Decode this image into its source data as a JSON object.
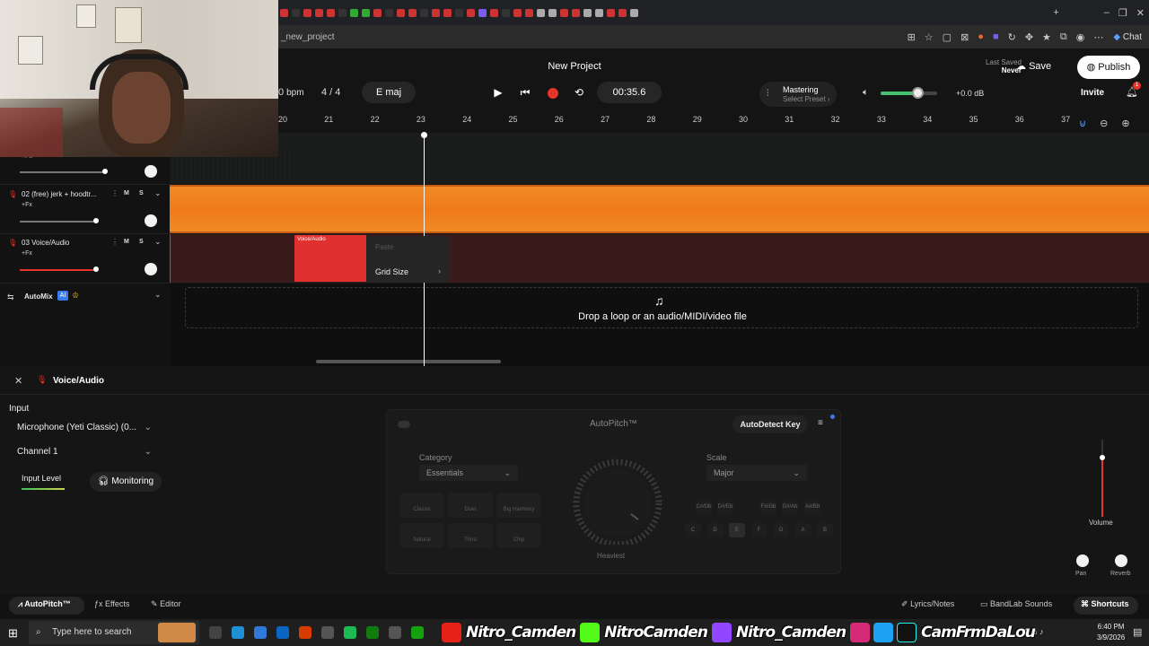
{
  "browser": {
    "url": "_new_project",
    "chat_label": "Chat"
  },
  "header": {
    "project_title": "New Project",
    "bpm_value": "0",
    "bpm_unit": "bpm",
    "time_signature": "4 / 4",
    "key": "E maj",
    "time": "00:35.6",
    "mastering_title": "Mastering",
    "mastering_sub": "Select Preset ›",
    "db": "+0.0 dB",
    "last_saved_label": "Last Saved",
    "last_saved_value": "Never",
    "save_label": "Save",
    "publish_label": "Publish",
    "invite_label": "Invite",
    "notifications": "1"
  },
  "ruler": [
    "20",
    "21",
    "22",
    "23",
    "24",
    "25",
    "26",
    "27",
    "28",
    "29",
    "30",
    "31",
    "32",
    "33",
    "34",
    "35",
    "36",
    "37"
  ],
  "tracks": [
    {
      "name": "",
      "fx": "+Fx"
    },
    {
      "name": "02  (free) jerk + hoodtr...",
      "fx": "+Fx",
      "m": "M",
      "s": "S"
    },
    {
      "name": "03  Voice/Audio",
      "fx": "+Fx",
      "m": "M",
      "s": "S",
      "clip": "Voice/Audio"
    }
  ],
  "automix": {
    "label": "AutoMix",
    "badge": "AI"
  },
  "dropzone": "Drop a loop or an audio/MIDI/video file",
  "context_menu": {
    "paste": "Paste",
    "grid": "Grid Size"
  },
  "panel": {
    "track_name": "Voice/Audio",
    "input_label": "Input",
    "mic": "Microphone (Yeti Classic) (0...",
    "channel": "Channel 1",
    "input_level": "Input Level",
    "monitoring": "Monitoring",
    "autopitch_title": "AutoPitch™",
    "autodetect": "AutoDetect Key",
    "category_label": "Category",
    "category_value": "Essentials",
    "scale_label": "Scale",
    "scale_value": "Major",
    "heaviest": "Heaviest",
    "presets": [
      "Classic",
      "Duet",
      "Big Harmony",
      "Natural",
      "Third",
      "Chip"
    ],
    "keys_top": [
      "C#/Db",
      "D#/Eb",
      "F#/Gb",
      "G#/Ab",
      "A#/Bb"
    ],
    "keys_bottom": [
      "C",
      "D",
      "E",
      "F",
      "G",
      "A",
      "B"
    ],
    "volume": "Volume",
    "pan": "Pan",
    "reverb": "Reverb"
  },
  "bottombar": {
    "autopitch": "AutoPitch™",
    "effects": "Effects",
    "editor": "Editor",
    "lyrics": "Lyrics/Notes",
    "sounds": "BandLab Sounds",
    "shortcuts": "Shortcuts"
  },
  "taskbar": {
    "search_placeholder": "Type here to search",
    "overlay": [
      "Nitro_Camden",
      "NitroCamden",
      "Nitro_Camden",
      "CamFrmDaLou"
    ],
    "time": "6:40 PM",
    "date": "3/9/2026"
  },
  "colors": {
    "accent": "#e5352b",
    "track2": "#f07a1a",
    "track1": "#e2ad2d",
    "green": "#47c26f"
  }
}
